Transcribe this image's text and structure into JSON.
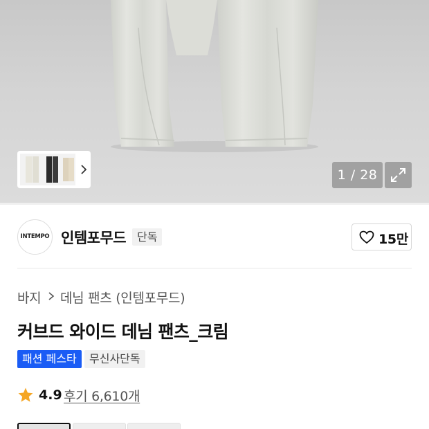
{
  "gallery": {
    "counter": "1 / 28",
    "thumbnail_icons": [
      "pants-thumbnail-cream",
      "pants-thumbnail-black",
      "pants-thumbnail-beige"
    ],
    "next_icon": "chevron-right-icon",
    "expand_icon": "expand-icon"
  },
  "brand": {
    "logo_text": "INTEMPO",
    "name": "인템포무드",
    "tag": "단독",
    "like_count": "15만",
    "like_icon": "heart-icon"
  },
  "breadcrumb": {
    "items": [
      "바지",
      "데님 팬츠 (인템포무드)"
    ],
    "separator_icon": "chevron-right-icon"
  },
  "product": {
    "title": "커브드 와이드 데님 팬츠_크림",
    "badges": {
      "promo": "패션 페스타",
      "exclusive": "무신사단독"
    }
  },
  "rating": {
    "score": "4.9",
    "reviews_label": "후기 6,610개",
    "star_icon": "star-icon",
    "star_color": "#f5a623"
  },
  "colors": {
    "accent_blue": "#1a5cf5",
    "option_count": 3,
    "selected_index": 0
  }
}
